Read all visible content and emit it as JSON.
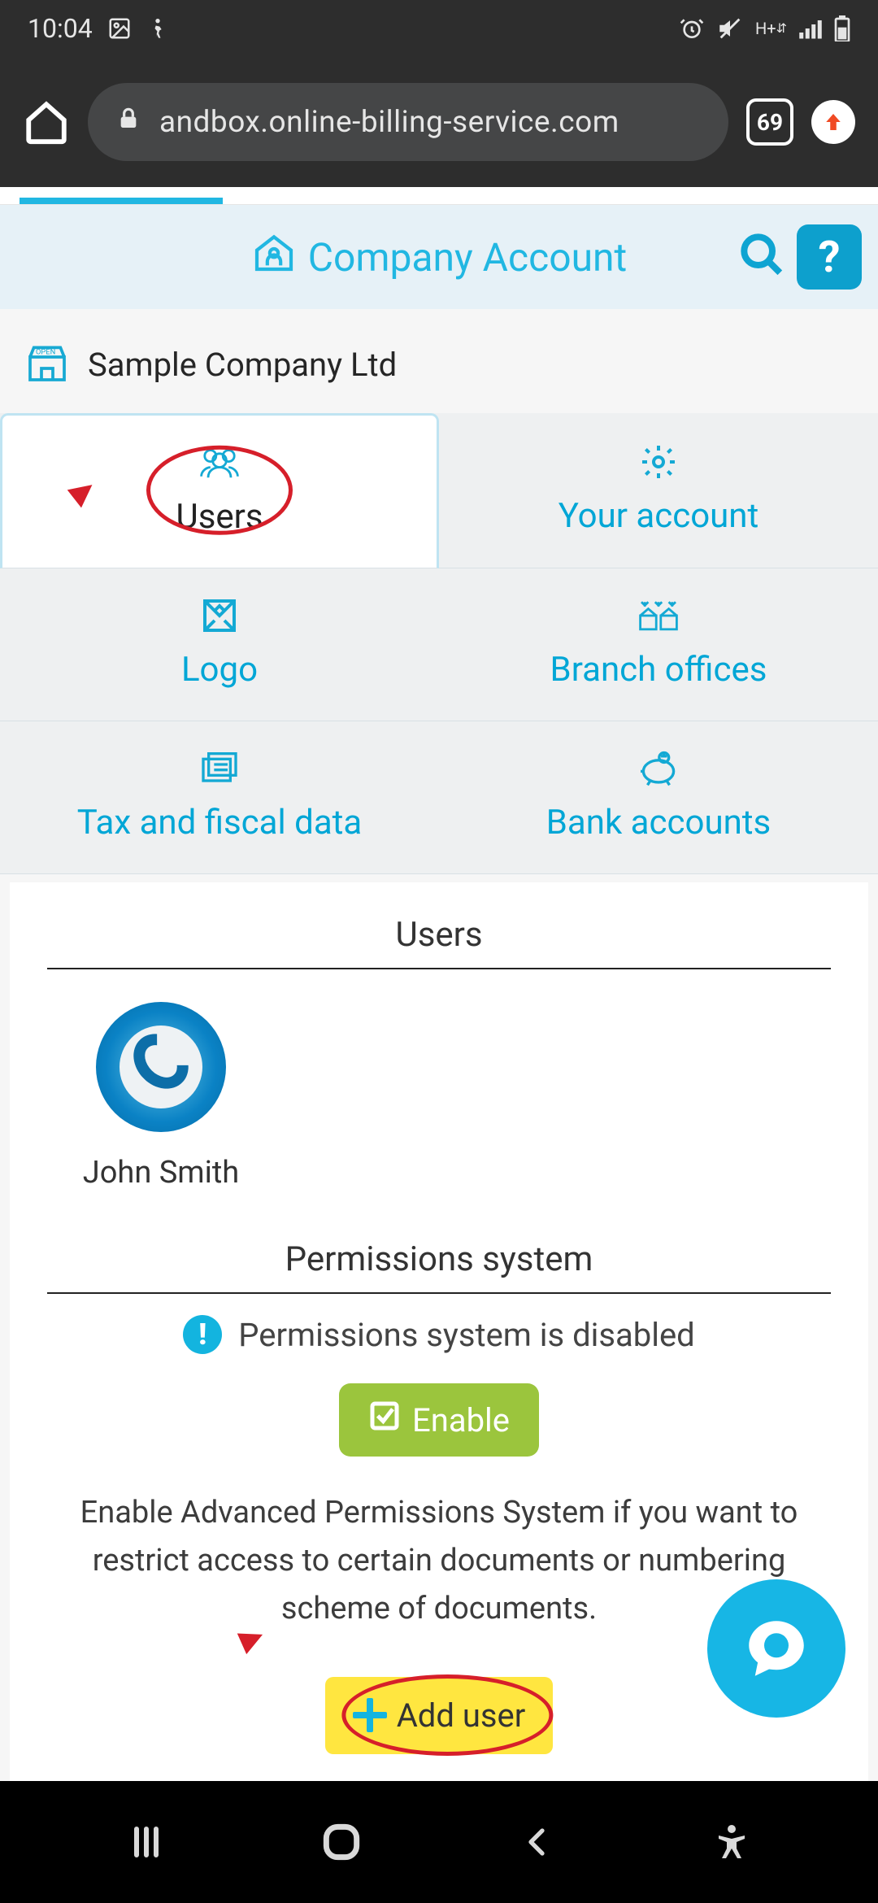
{
  "status_bar": {
    "time": "10:04",
    "tab_count": "69"
  },
  "browser": {
    "url": "andbox.online-billing-service.com"
  },
  "page": {
    "title": "Company Account",
    "help_label": "?",
    "company_name": "Sample Company Ltd"
  },
  "tabs": [
    {
      "label": "Users",
      "icon": "users-icon",
      "active": true
    },
    {
      "label": "Your account",
      "icon": "gear-icon",
      "active": false
    },
    {
      "label": "Logo",
      "icon": "logo-icon",
      "active": false
    },
    {
      "label": "Branch offices",
      "icon": "branches-icon",
      "active": false
    },
    {
      "label": "Tax and fiscal data",
      "icon": "tax-icon",
      "active": false
    },
    {
      "label": "Bank accounts",
      "icon": "bank-icon",
      "active": false
    }
  ],
  "users_section": {
    "heading": "Users",
    "items": [
      {
        "name": "John Smith"
      }
    ]
  },
  "permissions": {
    "heading": "Permissions system",
    "status_text": "Permissions system is disabled",
    "enable_label": "Enable",
    "description": "Enable Advanced Permissions System if you want to restrict access to certain documents or numbering scheme of documents."
  },
  "actions": {
    "add_user_label": "Add user"
  },
  "colors": {
    "accent": "#13b4df",
    "enable_green": "#9bc53d",
    "highlight_yellow": "#ffe640",
    "annotation_red": "#d61f2a"
  }
}
